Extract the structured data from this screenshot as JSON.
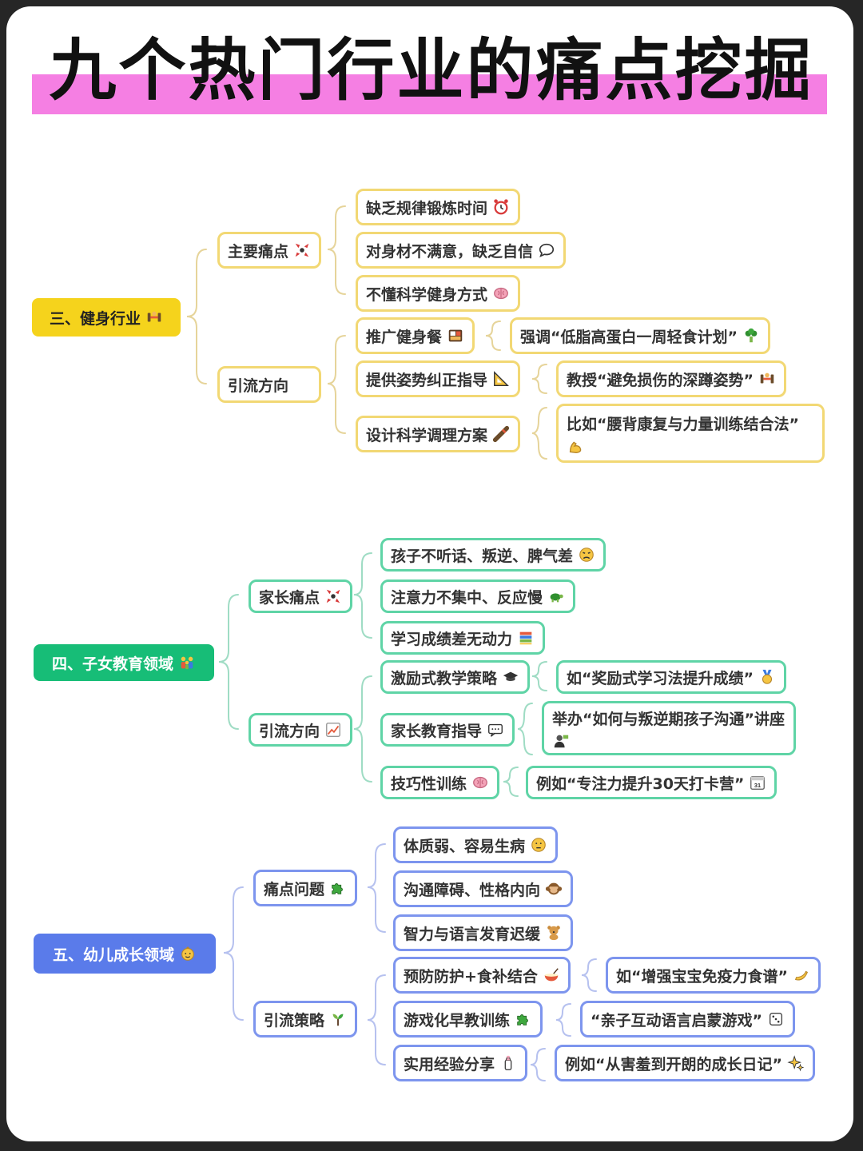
{
  "title": "九个热门行业的痛点挖掘",
  "sections": [
    {
      "label": "三、健身行业",
      "icon": "dumbbell-icon",
      "color": "#f5d31c",
      "branches": [
        {
          "label": "主要痛点",
          "icon": "anger-icon",
          "items": [
            {
              "text": "缺乏规律锻炼时间",
              "icon": "alarm-clock-icon"
            },
            {
              "text": "对身材不满意，缺乏自信",
              "icon": "speech-bubble-icon"
            },
            {
              "text": "不懂科学健身方式",
              "icon": "brain-icon"
            }
          ]
        },
        {
          "label": "引流方向",
          "icon": "magnet-icon",
          "items": [
            {
              "text": "推广健身餐",
              "icon": "bento-box-icon",
              "detail": "强调“低脂高蛋白一周轻食计划”",
              "detail_icon": "broccoli-icon"
            },
            {
              "text": "提供姿势纠正指导",
              "icon": "triangle-ruler-icon",
              "detail": "教授“避免损伤的深蹲姿势”",
              "detail_icon": "dumbbell-icon"
            },
            {
              "text": "设计科学调理方案",
              "icon": "candy-icon",
              "detail": "比如“腰背康复与力量训练结合法”",
              "detail_icon": "flexed-bicep-icon"
            }
          ]
        }
      ]
    },
    {
      "label": "四、子女教育领域",
      "icon": "family-icon",
      "color": "#17bd77",
      "branches": [
        {
          "label": "家长痛点",
          "icon": "anger-icon",
          "items": [
            {
              "text": "孩子不听话、叛逆、脾气差",
              "icon": "angry-face-icon"
            },
            {
              "text": "注意力不集中、反应慢",
              "icon": "turtle-icon"
            },
            {
              "text": "学习成绩差无动力",
              "icon": "books-icon"
            }
          ]
        },
        {
          "label": "引流方向",
          "icon": "chart-icon",
          "items": [
            {
              "text": "激励式教学策略",
              "icon": "graduation-cap-icon",
              "detail": "如“奖励式学习法提升成绩”",
              "detail_icon": "medal-icon"
            },
            {
              "text": "家长教育指导",
              "icon": "speech-balloon-icon",
              "detail": "举办“如何与叛逆期孩子沟通”讲座",
              "detail_icon": "teacher-icon"
            },
            {
              "text": "技巧性训练",
              "icon": "brain-icon",
              "detail": "例如“专注力提升30天打卡营”",
              "detail_icon": "calendar-icon"
            }
          ]
        }
      ]
    },
    {
      "label": "五、幼儿成长领域",
      "icon": "baby-icon",
      "color": "#5a7bea",
      "branches": [
        {
          "label": "痛点问题",
          "icon": "puzzle-icon",
          "items": [
            {
              "text": "体质弱、容易生病",
              "icon": "sick-face-icon"
            },
            {
              "text": "沟通障碍、性格内向",
              "icon": "shy-monkey-icon"
            },
            {
              "text": "智力与语言发育迟缓",
              "icon": "teddy-bear-icon"
            }
          ]
        },
        {
          "label": "引流策略",
          "icon": "seedling-icon",
          "items": [
            {
              "text": "预防防护+食补结合",
              "icon": "food-bowl-icon",
              "detail": "如“增强宝宝免疫力食谱”",
              "detail_icon": "banana-icon"
            },
            {
              "text": "游戏化早教训练",
              "icon": "puzzle-icon",
              "detail": "“亲子互动语言启蒙游戏”",
              "detail_icon": "dice-icon"
            },
            {
              "text": "实用经验分享",
              "icon": "baby-bottle-icon",
              "detail": "例如“从害羞到开朗的成长日记”",
              "detail_icon": "sparkles-icon"
            }
          ]
        }
      ]
    }
  ]
}
